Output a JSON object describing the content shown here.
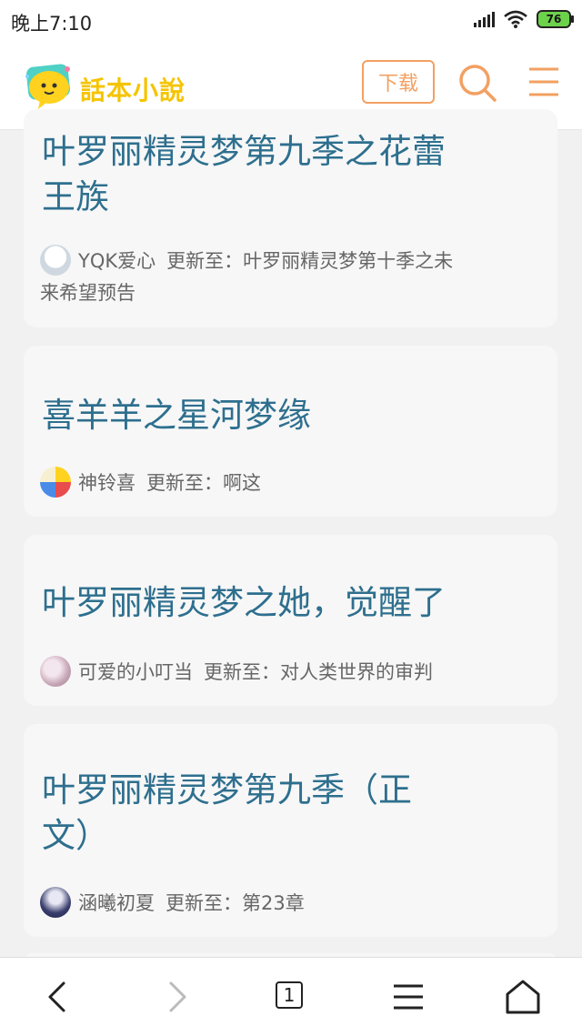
{
  "status_bar": {
    "time": "晚上7:10",
    "battery": "76"
  },
  "header": {
    "logo_text": "話本小說",
    "download_label": "下载"
  },
  "colors": {
    "accent": "#f2a062",
    "title": "#2e6f8e",
    "logo": "#f5c400"
  },
  "cards": [
    {
      "title_line1": "叶罗丽精灵梦第九季之花蕾",
      "title_line2": "王族",
      "author": "YQK爱心",
      "update_line1": "更新至：叶罗丽精灵梦第十季之未",
      "update_line2": "来希望预告"
    },
    {
      "title": "喜羊羊之星河梦缘",
      "author": "神铃喜",
      "update": "更新至：啊这"
    },
    {
      "title": "叶罗丽精灵梦之她，觉醒了",
      "author": "可爱的小叮当",
      "update": "更新至：对人类世界的审判"
    },
    {
      "title_line1": "叶罗丽精灵梦第九季（正",
      "title_line2": "文）",
      "author": "涵曦初夏",
      "update": "更新至：第23章"
    }
  ],
  "bottom_nav": {
    "tab_count": "1"
  }
}
